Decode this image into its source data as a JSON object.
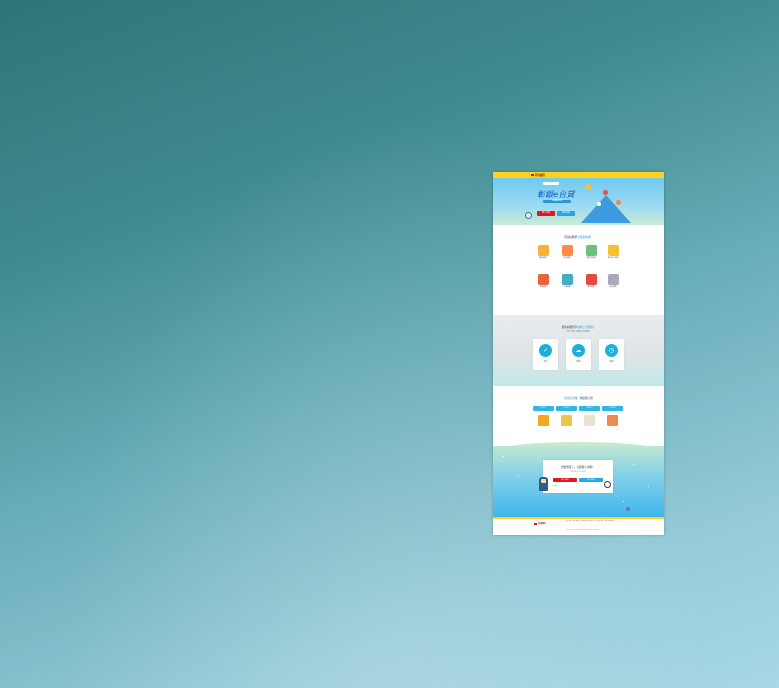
{
  "hero": {
    "badge": "一 + 一",
    "title": "彰銀e台貸",
    "subtitle": "好康報你知",
    "btn_apply": "線上申辦",
    "btn_info": "貸款試算"
  },
  "section1": {
    "title_prefix": "貸款好簡單",
    "title_highlight": "方案隨你選",
    "title_suffix": "！",
    "items": [
      {
        "label": "購屋貸款",
        "icon": "house-icon",
        "color": "#f4b23a"
      },
      {
        "label": "信用貸款",
        "icon": "chart-icon",
        "color": "#ff8a4c"
      },
      {
        "label": "理財型房貸",
        "icon": "building-icon",
        "color": "#6cc07a"
      },
      {
        "label": "青年安心成家",
        "icon": "gift-icon",
        "color": "#f2c233"
      },
      {
        "label": "房屋修繕",
        "icon": "home-repair-icon",
        "color": "#e8643a"
      },
      {
        "label": "汽車貸款",
        "icon": "car-icon",
        "color": "#3fb0c4"
      },
      {
        "label": "消費貸款",
        "icon": "person-icon",
        "color": "#e64a3f"
      },
      {
        "label": "其他貸款",
        "icon": "document-icon",
        "color": "#a9a9b8"
      }
    ]
  },
  "section2": {
    "title_prefix": "貸款好簡單",
    "title_highlight": "申請線上全程辦",
    "title_suffix": "！",
    "subtitle": "線上申請 免臨櫃 省時便利",
    "cards": [
      {
        "label": "安全",
        "icon": "shield-icon"
      },
      {
        "label": "便利",
        "icon": "cloud-icon"
      },
      {
        "label": "快速",
        "icon": "clock-icon"
      }
    ]
  },
  "section3": {
    "title_highlight": "貸款四步驟",
    "title_suffix": "．輕鬆線上辦",
    "steps": [
      {
        "label": "STEP 1",
        "icon": "monitor-icon",
        "color": "#f5a623"
      },
      {
        "label": "STEP 2",
        "icon": "clipboard-icon",
        "color": "#f0c24a"
      },
      {
        "label": "STEP 3",
        "icon": "paper-icon",
        "color": "#e9e2d0"
      },
      {
        "label": "STEP 4",
        "icon": "calendar-icon",
        "color": "#f08a4b"
      }
    ]
  },
  "section4": {
    "question": "想要申貸了，立即線上申辦！",
    "note": "彰化銀行 全心全意",
    "btn_apply": "線上申辦",
    "btn_consult": "線上諮詢",
    "fine_print": "注意事項"
  },
  "footer": {
    "logo": "彰化銀行",
    "links": "客戶服務 | 隱私權政策 | 網站地圖 | 聯絡我們 | 資訊安全政策 | 金融消費者保護",
    "copyright": "Copyright © Chang Hwa Bank. All Rights Reserved."
  },
  "header": {
    "logo": "彰化銀行"
  }
}
